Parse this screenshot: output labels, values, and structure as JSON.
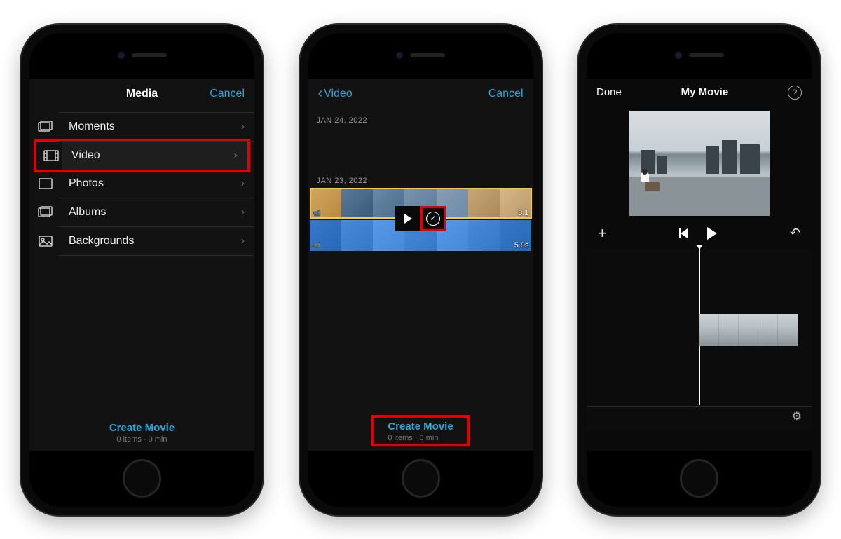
{
  "screen1": {
    "title": "Media",
    "cancel": "Cancel",
    "rows": {
      "moments": "Moments",
      "video": "Video",
      "photos": "Photos",
      "albums": "Albums",
      "backgrounds": "Backgrounds"
    },
    "create_movie": "Create Movie",
    "items_count": "0 items · 0 min"
  },
  "screen2": {
    "back_label": "Video",
    "cancel": "Cancel",
    "date1": "JAN 24, 2022",
    "date2": "JAN 23, 2022",
    "clip1_duration": "8.1",
    "clip2_duration": "5.9s",
    "create_movie": "Create Movie",
    "items_count": "0 items · 0 min"
  },
  "screen3": {
    "done": "Done",
    "title": "My Movie",
    "help": "?"
  }
}
